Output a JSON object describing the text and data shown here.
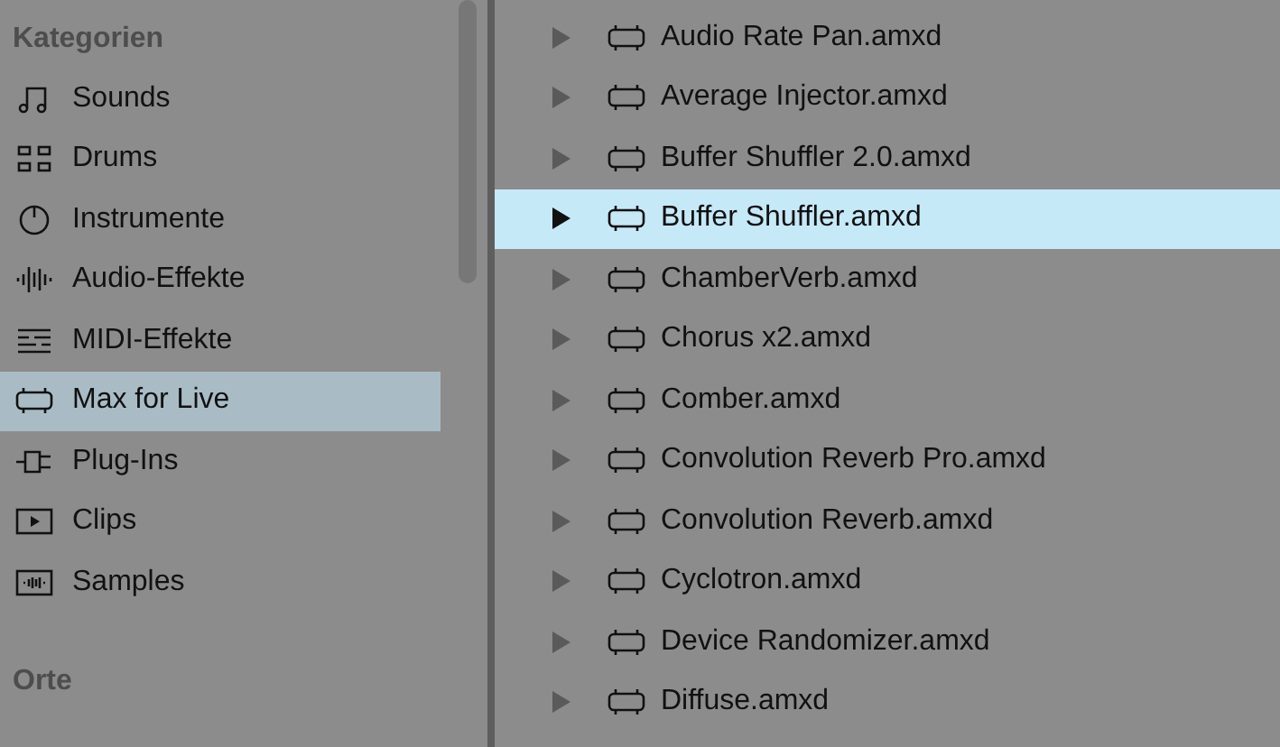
{
  "sidebar": {
    "sections": [
      {
        "title": "Kategorien",
        "items": [
          {
            "label": "Sounds",
            "kind": "sounds",
            "selected": false
          },
          {
            "label": "Drums",
            "kind": "drums",
            "selected": false
          },
          {
            "label": "Instrumente",
            "kind": "instruments",
            "selected": false
          },
          {
            "label": "Audio-Effekte",
            "kind": "audio",
            "selected": false
          },
          {
            "label": "MIDI-Effekte",
            "kind": "midi",
            "selected": false
          },
          {
            "label": "Max for Live",
            "kind": "max",
            "selected": true
          },
          {
            "label": "Plug-Ins",
            "kind": "plugins",
            "selected": false
          },
          {
            "label": "Clips",
            "kind": "clips",
            "selected": false
          },
          {
            "label": "Samples",
            "kind": "samples",
            "selected": false
          }
        ]
      },
      {
        "title": "Orte"
      }
    ]
  },
  "files": [
    {
      "name": "Audio Rate Pan.amxd",
      "selected": false
    },
    {
      "name": "Average Injector.amxd",
      "selected": false
    },
    {
      "name": "Buffer Shuffler 2.0.amxd",
      "selected": false
    },
    {
      "name": "Buffer Shuffler.amxd",
      "selected": true
    },
    {
      "name": "ChamberVerb.amxd",
      "selected": false
    },
    {
      "name": "Chorus x2.amxd",
      "selected": false
    },
    {
      "name": "Comber.amxd",
      "selected": false
    },
    {
      "name": "Convolution Reverb Pro.amxd",
      "selected": false
    },
    {
      "name": "Convolution Reverb.amxd",
      "selected": false
    },
    {
      "name": "Cyclotron.amxd",
      "selected": false
    },
    {
      "name": "Device Randomizer.amxd",
      "selected": false
    },
    {
      "name": "Diffuse.amxd",
      "selected": false
    }
  ]
}
